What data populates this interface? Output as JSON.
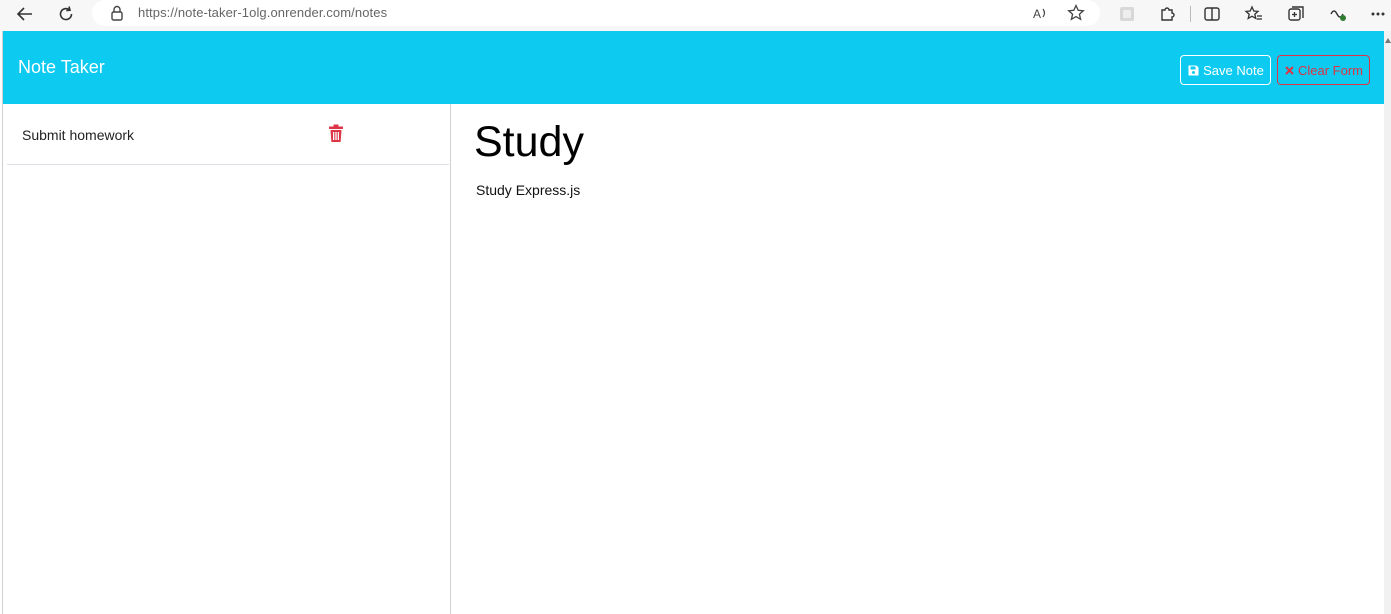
{
  "browser": {
    "url": "https://note-taker-1olg.onrender.com/notes",
    "icons": [
      "back-icon",
      "refresh-icon",
      "lock-icon",
      "read-aloud-icon",
      "favorite-star-icon",
      "extension-icon",
      "puzzle-icon",
      "split-screen-icon",
      "favorites-icon",
      "collections-icon",
      "performance-icon",
      "more-icon"
    ]
  },
  "navbar": {
    "brand": "Note Taker",
    "save_label": "Save Note",
    "clear_label": "Clear Form",
    "colors": {
      "bg": "#0dcaf0",
      "clear": "#dc3545"
    }
  },
  "sidebar": {
    "items": [
      {
        "label": "Submit homework"
      }
    ]
  },
  "note": {
    "title": "Study",
    "text": "Study Express.js"
  }
}
